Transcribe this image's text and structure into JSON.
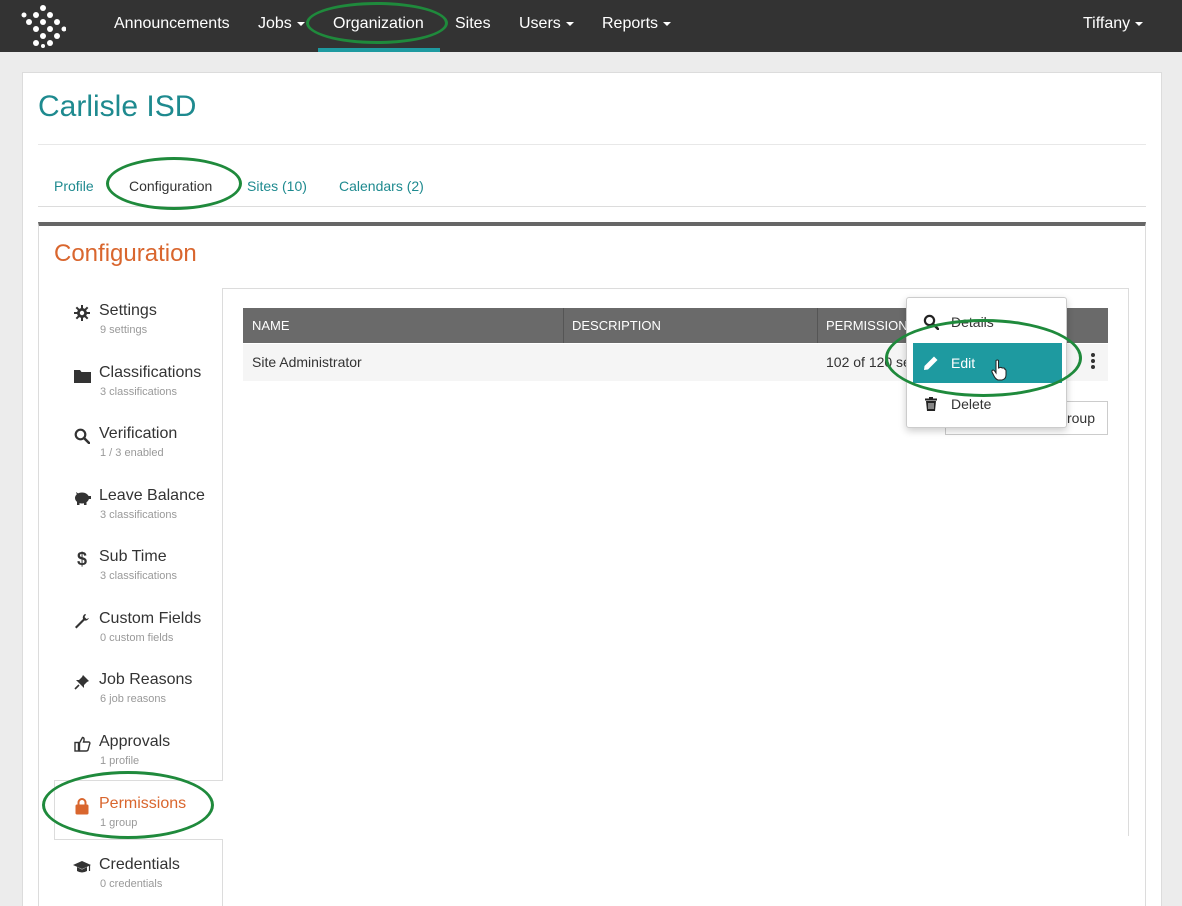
{
  "nav": {
    "items": [
      {
        "label": "Announcements",
        "has_caret": false
      },
      {
        "label": "Jobs",
        "has_caret": true
      },
      {
        "label": "Organization",
        "has_caret": false
      },
      {
        "label": "Sites",
        "has_caret": false
      },
      {
        "label": "Users",
        "has_caret": true
      },
      {
        "label": "Reports",
        "has_caret": true
      }
    ],
    "active": "Organization",
    "user": "Tiffany"
  },
  "page": {
    "title": "Carlisle ISD",
    "tabs": [
      {
        "label": "Profile"
      },
      {
        "label": "Configuration"
      },
      {
        "label": "Sites (10)"
      },
      {
        "label": "Calendars (2)"
      }
    ],
    "active_tab": "Configuration"
  },
  "config": {
    "title": "Configuration",
    "sidebar": [
      {
        "label": "Settings",
        "sub": "9 settings",
        "icon": "gear-icon"
      },
      {
        "label": "Classifications",
        "sub": "3 classifications",
        "icon": "folder-icon"
      },
      {
        "label": "Verification",
        "sub": "1 / 3 enabled",
        "icon": "search-icon"
      },
      {
        "label": "Leave Balance",
        "sub": "3 classifications",
        "icon": "piggy-bank-icon"
      },
      {
        "label": "Sub Time",
        "sub": "3 classifications",
        "icon": "dollar-icon"
      },
      {
        "label": "Custom Fields",
        "sub": "0 custom fields",
        "icon": "wrench-icon"
      },
      {
        "label": "Job Reasons",
        "sub": "6 job reasons",
        "icon": "pin-icon"
      },
      {
        "label": "Approvals",
        "sub": "1 profile",
        "icon": "thumbs-up-icon"
      },
      {
        "label": "Permissions",
        "sub": "1 group",
        "icon": "lock-icon"
      },
      {
        "label": "Credentials",
        "sub": "0 credentials",
        "icon": "graduation-cap-icon"
      }
    ],
    "active_item": "Permissions"
  },
  "table": {
    "columns": [
      "NAME",
      "DESCRIPTION",
      "PERMISSIONS"
    ],
    "rows": [
      {
        "name": "Site Administrator",
        "description": "",
        "permissions": "102 of 120 se"
      }
    ]
  },
  "add_button_label": "roup",
  "dropdown": {
    "items": [
      {
        "label": "Details",
        "icon": "search-icon"
      },
      {
        "label": "Edit",
        "icon": "pencil-icon"
      },
      {
        "label": "Delete",
        "icon": "trash-icon"
      }
    ],
    "highlighted": "Edit"
  },
  "colors": {
    "nav_bg": "#333333",
    "accent_teal": "#1e9aa0",
    "accent_orange": "#d9662e",
    "annotation_green": "#1f8a3c"
  }
}
